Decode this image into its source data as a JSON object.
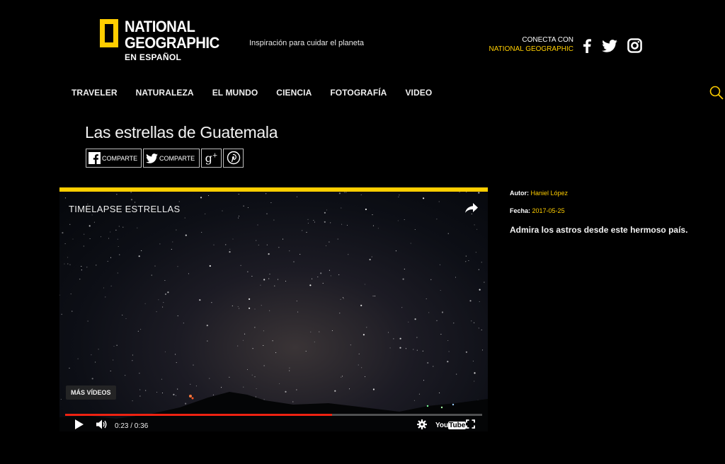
{
  "brand": {
    "line1": "NATIONAL",
    "line2": "GEOGRAPHIC",
    "line3": "EN ESPAÑOL",
    "accent": "#ffce00",
    "tagline": "Inspiración para cuidar el planeta"
  },
  "connect": {
    "line1": "CONECTA CON",
    "line2": "NATIONAL GEOGRAPHIC",
    "icons": [
      "facebook-icon",
      "twitter-icon",
      "instagram-icon"
    ]
  },
  "nav": {
    "items": [
      "TRAVELER",
      "NATURALEZA",
      "EL MUNDO",
      "CIENCIA",
      "FOTOGRAFÍA",
      "VIDEO"
    ],
    "search_icon": "search-icon"
  },
  "article": {
    "title": "Las estrellas de Guatemala",
    "share": {
      "facebook_label": "COMPARTE",
      "twitter_label": "COMPARTE",
      "gplus_icon": "google-plus-icon",
      "pinterest_icon": "pinterest-icon"
    }
  },
  "video": {
    "title": "TIMELAPSE ESTRELLAS",
    "more_videos": "MÁS VÍDEOS",
    "current_time": "0:23",
    "duration": "0:36",
    "time_display": "0:23 / 0:36",
    "progress": 0.64,
    "yt_label_a": "You",
    "yt_label_b": "Tube"
  },
  "sidebar": {
    "author_label": "Autor:",
    "author_value": "Haniel López",
    "date_label": "Fecha:",
    "date_value": "2017-05-25",
    "description": "Admira los astros desde este hermoso país."
  }
}
